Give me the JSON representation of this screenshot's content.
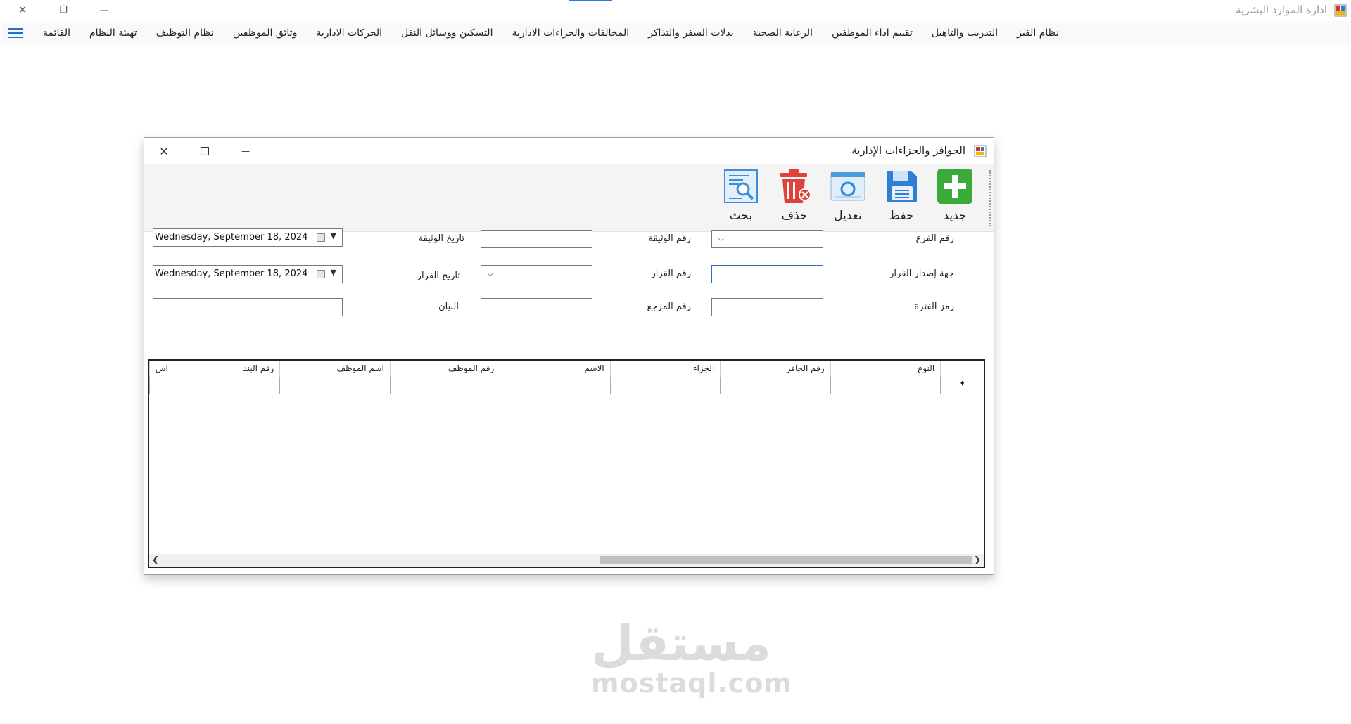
{
  "app": {
    "title": "ادارة الموارد البشرية"
  },
  "window_buttons": {
    "close": "✕",
    "restore": "❐",
    "minimize": "—"
  },
  "menu": {
    "items": [
      "القائمة",
      "تهيئة النظام",
      "نظام التوظيف",
      "وثائق الموظفين",
      "الحركات الادارية",
      "التسكين ووسائل النقل",
      "المخالفات والجزاءات الادارية",
      "بدلات السفر والتذاكر",
      "الرعاية الصحية",
      "تقييم اداء الموظفين",
      "التدريب والتاهيل",
      "نظام الفيز"
    ]
  },
  "form": {
    "title": "الحوافز والجزاءات الإدارية",
    "toolbar": {
      "new": "جديد",
      "save": "حفظ",
      "edit": "تعديل",
      "delete": "حذف",
      "search": "بحث"
    },
    "labels": {
      "branch_no": "رقم الفرع",
      "doc_no": "رقم الوثيقة",
      "doc_date": "تاريخ الوثيقة",
      "issuer": "جهة إصدار القرار",
      "decision_no": "رقم القرار",
      "decision_date": "تاريخ القرار",
      "period_code": "رمز الفترة",
      "ref_no": "رقم المرجع",
      "statement": "البيان"
    },
    "values": {
      "doc_date": "Wednesday, September 18, 2024",
      "decision_date": "Wednesday, September 18, 2024"
    }
  },
  "grid": {
    "columns": [
      "النوع",
      "رقم الحافز",
      "الجزاء",
      "الاسم",
      "رقم الموظف",
      "اسم الموظف",
      "رقم البند",
      "اس"
    ],
    "new_row_marker": "*"
  },
  "watermark": {
    "ar": "مستقل",
    "en": "mostaql.com"
  }
}
